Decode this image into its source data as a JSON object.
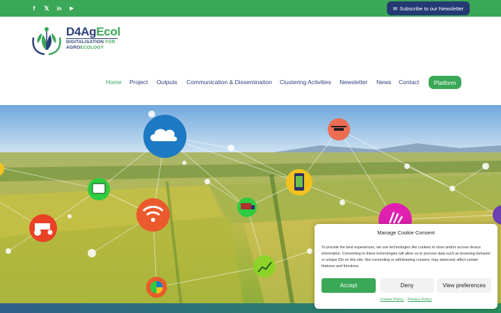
{
  "colors": {
    "green": "#3aa857",
    "navy": "#253a73",
    "text": "#2b3f78"
  },
  "social": [
    {
      "icon": "facebook-icon",
      "glyph": "f"
    },
    {
      "icon": "x-icon",
      "glyph": "𝕏"
    },
    {
      "icon": "linkedin-icon",
      "glyph": "in"
    },
    {
      "icon": "youtube-icon",
      "glyph": "▶"
    }
  ],
  "topbar": {
    "subscribe_label": "Subscribe to our Newsletter"
  },
  "logo": {
    "title_part1": "D4Ag",
    "title_part2": "Ecol",
    "sub1_part1": "DIGITALISATION ",
    "sub1_part2": "FOR",
    "sub2_part1": "AGRO",
    "sub2_part2": "ECOLOGY"
  },
  "nav": {
    "items": [
      "Home",
      "Project",
      "Outputs",
      "Communication & Dissemination",
      "Clustering Activities",
      "Newsletter",
      "News",
      "Contact"
    ],
    "platform_label": "Platform"
  },
  "cookie": {
    "title": "Manage Cookie Consent",
    "text": "To provide the best experiences, we use technologies like cookies to store and/or access device information. Consenting to these technologies will allow us to process data such as browsing behavior or unique IDs on this site. Not consenting or withdrawing consent, may adversely affect certain features and functions.",
    "accept": "Accept",
    "deny": "Deny",
    "preferences": "View preferences",
    "cookie_policy": "Cookie Policy",
    "privacy_policy": "Privacy Policy"
  }
}
